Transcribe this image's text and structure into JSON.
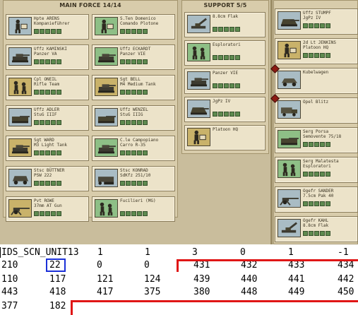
{
  "main_force": {
    "title": "MAIN FORCE 14/14",
    "units": [
      {
        "name": [
          "Hpte ARENS",
          "Kompanieführer"
        ],
        "thumb": "blue",
        "icon": "officer-icon",
        "pips": 5
      },
      {
        "name": [
          "S.Ten Domenico",
          "Comando Plotone"
        ],
        "thumb": "green",
        "icon": "officer-icon",
        "pips": 5
      },
      {
        "name": [
          "Uffz KAMINSKI",
          "Panzer VA"
        ],
        "thumb": "blue",
        "icon": "tank-icon",
        "pips": 5
      },
      {
        "name": [
          "Uffz ECKARDT",
          "Panzer VIE"
        ],
        "thumb": "green",
        "icon": "tank-icon",
        "pips": 5
      },
      {
        "name": [
          "Cpl ONEIL",
          "Rifle Team"
        ],
        "thumb": "tan",
        "icon": "infantry-icon",
        "pips": 5
      },
      {
        "name": [
          "Sgt BELL",
          "M4 Medium Tank"
        ],
        "thumb": "tan",
        "icon": "tank-icon",
        "pips": 5
      },
      {
        "name": [
          "Uffz ADLER",
          "StuG IIIF"
        ],
        "thumb": "blue",
        "icon": "assault-gun-icon",
        "pips": 5
      },
      {
        "name": [
          "Uffz WENZEL",
          "StuG IIIG"
        ],
        "thumb": "blue",
        "icon": "assault-gun-icon",
        "pips": 5
      },
      {
        "name": [
          "Sgt WARD",
          "M3 Light Tank"
        ],
        "thumb": "tan",
        "icon": "tank-icon",
        "pips": 5
      },
      {
        "name": [
          "C.le Campopiano",
          "Carro R-35"
        ],
        "thumb": "green",
        "icon": "tank-icon",
        "pips": 5
      },
      {
        "name": [
          "Stsc BÜTTNER",
          "PSW 222"
        ],
        "thumb": "blue",
        "icon": "armored-car-icon",
        "pips": 5
      },
      {
        "name": [
          "Stsc KONRAD",
          "SdKfz 251/10"
        ],
        "thumb": "blue",
        "icon": "halftrack-icon",
        "pips": 5
      },
      {
        "name": [
          "Pvt ROWE",
          "37mm AT Gun"
        ],
        "thumb": "tan",
        "icon": "at-gun-icon",
        "pips": 5
      },
      {
        "name": [
          "Fucilieri (MG)"
        ],
        "thumb": "green",
        "icon": "infantry-icon",
        "pips": 5
      }
    ]
  },
  "support": {
    "title": "SUPPORT 5/5",
    "units": [
      {
        "name": [
          "8.8cm Flak"
        ],
        "thumb": "blue",
        "icon": "flak-icon",
        "pips": 5
      },
      {
        "name": [
          "Esploratori"
        ],
        "thumb": "green",
        "icon": "infantry-icon",
        "pips": 5
      },
      {
        "name": [
          "Panzer VIE"
        ],
        "thumb": "blue",
        "icon": "tank-icon",
        "pips": 5
      },
      {
        "name": [
          "JgPz IV"
        ],
        "thumb": "blue",
        "icon": "tank-destroyer-icon",
        "pips": 5
      },
      {
        "name": [
          "Platoon HQ"
        ],
        "thumb": "tan",
        "icon": "officer-icon",
        "pips": 0
      }
    ]
  },
  "reserve": {
    "units": [
      {
        "name": [
          "Uffz STUMPF",
          "JgPz IV"
        ],
        "thumb": "blue",
        "icon": "tank-destroyer-icon",
        "pips": 5,
        "marked": false
      },
      {
        "name": [
          "2d Lt JENKINS",
          "Platoon HQ"
        ],
        "thumb": "tan",
        "icon": "officer-icon",
        "pips": 5,
        "marked": false
      },
      {
        "name": [
          "Kubelwagen"
        ],
        "thumb": "blue",
        "icon": "car-icon",
        "pips": 0,
        "marked": true
      },
      {
        "name": [
          "Opel Blitz"
        ],
        "thumb": "blue",
        "icon": "truck-icon",
        "pips": 0,
        "marked": true
      },
      {
        "name": [
          "Serg Porsa",
          "Semovente 75/18"
        ],
        "thumb": "green",
        "icon": "assault-gun-icon",
        "pips": 5,
        "marked": false
      },
      {
        "name": [
          "Serg Malatesta",
          "Esploratori"
        ],
        "thumb": "green",
        "icon": "infantry-icon",
        "pips": 5,
        "marked": false
      },
      {
        "name": [
          "Ogefr SANDER",
          "7.5cm Pak 40"
        ],
        "thumb": "blue",
        "icon": "at-gun-icon",
        "pips": 5,
        "marked": false
      },
      {
        "name": [
          "Ogefr KAHL",
          "8.8cm Flak"
        ],
        "thumb": "blue",
        "icon": "flak-icon",
        "pips": 5,
        "marked": false
      }
    ]
  },
  "data_table": {
    "rows": [
      [
        "IDS_SCN_UNIT13",
        "1",
        "1",
        "3",
        "0",
        "1",
        "-1"
      ],
      [
        "210",
        "22",
        "0",
        "0",
        "431",
        "432",
        "433",
        "434"
      ],
      [
        "110",
        "117",
        "121",
        "124",
        "439",
        "440",
        "441",
        "442"
      ],
      [
        "443",
        "418",
        "417",
        "375",
        "380",
        "448",
        "449",
        "450"
      ],
      [
        "377",
        "182"
      ]
    ],
    "highlighted_value": "22",
    "highlight_color": "#1b30d8",
    "region_line_color": "#e01616"
  },
  "colors": {
    "board": "#c9bd9c",
    "card": "#ece3c9"
  }
}
